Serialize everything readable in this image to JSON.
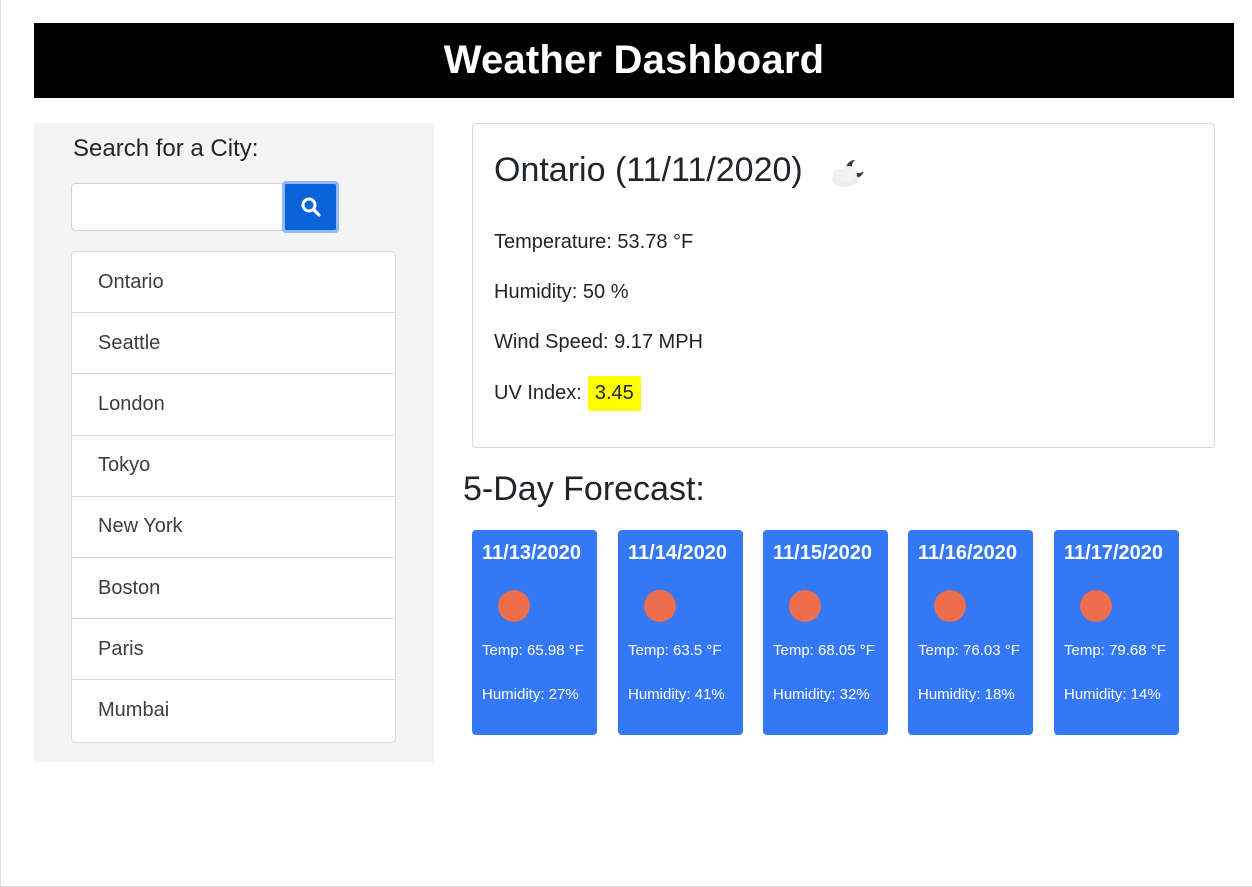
{
  "header": {
    "title": "Weather Dashboard"
  },
  "sidebar": {
    "search_label": "Search for a City:",
    "search_input": {
      "value": "",
      "placeholder": ""
    },
    "search_button_icon": "search-icon",
    "cities": [
      "Ontario",
      "Seattle",
      "London",
      "Tokyo",
      "New York",
      "Boston",
      "Paris",
      "Mumbai"
    ]
  },
  "current": {
    "title": "Ontario (11/11/2020)",
    "icon": "partly-cloudy-night-icon",
    "temperature": "Temperature: 53.78 °F",
    "humidity": "Humidity: 50 %",
    "wind_speed": "Wind Speed: 9.17 MPH",
    "uv_label": "UV Index:",
    "uv_value": "3.45",
    "uv_color": "#ffff00"
  },
  "forecast": {
    "title": "5-Day Forecast:",
    "card_color": "#3478f6",
    "icon": "sun-icon",
    "icon_color": "#ec6e4c",
    "days": [
      {
        "date": "11/13/2020",
        "temp": "Temp: 65.98 °F",
        "humidity": "Humidity: 27%"
      },
      {
        "date": "11/14/2020",
        "temp": "Temp: 63.5 °F",
        "humidity": "Humidity: 41%"
      },
      {
        "date": "11/15/2020",
        "temp": "Temp: 68.05 °F",
        "humidity": "Humidity: 32%"
      },
      {
        "date": "11/16/2020",
        "temp": "Temp: 76.03 °F",
        "humidity": "Humidity: 18%"
      },
      {
        "date": "11/17/2020",
        "temp": "Temp: 79.68 °F",
        "humidity": "Humidity: 14%"
      }
    ]
  }
}
